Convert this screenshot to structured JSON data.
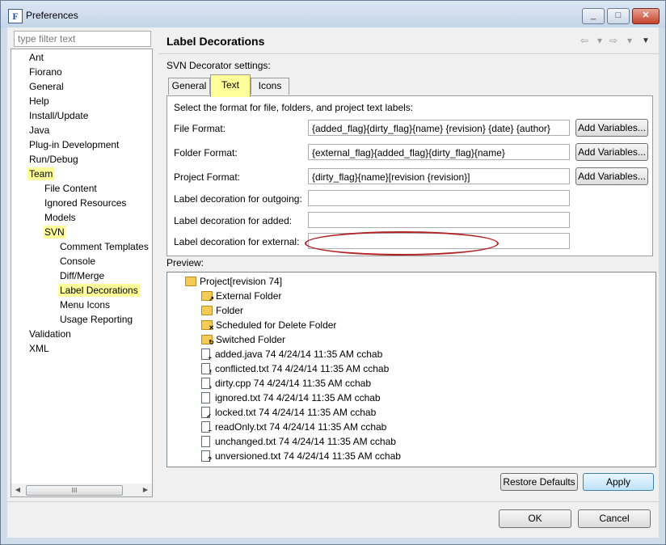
{
  "window": {
    "title": "Preferences",
    "app_icon_letter": "F",
    "buttons": {
      "minimize": "_",
      "maximize": "□",
      "close": "✕"
    }
  },
  "sidebar": {
    "filter_placeholder": "type filter text",
    "items": [
      {
        "label": "Ant",
        "level": 0,
        "highlight": false
      },
      {
        "label": "Fiorano",
        "level": 0,
        "highlight": false
      },
      {
        "label": "General",
        "level": 0,
        "highlight": false
      },
      {
        "label": "Help",
        "level": 0,
        "highlight": false
      },
      {
        "label": "Install/Update",
        "level": 0,
        "highlight": false
      },
      {
        "label": "Java",
        "level": 0,
        "highlight": false
      },
      {
        "label": "Plug-in Development",
        "level": 0,
        "highlight": false
      },
      {
        "label": "Run/Debug",
        "level": 0,
        "highlight": false
      },
      {
        "label": "Team",
        "level": 0,
        "highlight": true
      },
      {
        "label": "File Content",
        "level": 1,
        "highlight": false
      },
      {
        "label": "Ignored Resources",
        "level": 1,
        "highlight": false
      },
      {
        "label": "Models",
        "level": 1,
        "highlight": false
      },
      {
        "label": "SVN",
        "level": 1,
        "highlight": true
      },
      {
        "label": "Comment Templates",
        "level": 2,
        "highlight": false
      },
      {
        "label": "Console",
        "level": 2,
        "highlight": false
      },
      {
        "label": "Diff/Merge",
        "level": 2,
        "highlight": false
      },
      {
        "label": "Label Decorations",
        "level": 2,
        "highlight": true
      },
      {
        "label": "Menu Icons",
        "level": 2,
        "highlight": false
      },
      {
        "label": "Usage Reporting",
        "level": 2,
        "highlight": false
      },
      {
        "label": "Validation",
        "level": 0,
        "highlight": false
      },
      {
        "label": "XML",
        "level": 0,
        "highlight": false
      }
    ],
    "scroll": {
      "left_arrow": "◀",
      "right_arrow": "▶",
      "grip": "III"
    }
  },
  "header": {
    "title": "Label Decorations",
    "nav": {
      "back": "⇦",
      "back_menu": "▾",
      "forward": "⇨",
      "forward_menu": "▾",
      "view_menu": "▼"
    }
  },
  "settings_label": "SVN Decorator settings:",
  "tabs": [
    {
      "label": "General",
      "active": false
    },
    {
      "label": "Text",
      "active": true
    },
    {
      "label": "Icons",
      "active": false
    }
  ],
  "text_tab": {
    "instructions": "Select the format for file, folders, and project text labels:",
    "rows": [
      {
        "label": "File Format:",
        "value": "{added_flag}{dirty_flag}{name} {revision}  {date}  {author}",
        "button": "Add Variables..."
      },
      {
        "label": "Folder Format:",
        "value": "{external_flag}{added_flag}{dirty_flag}{name}",
        "button": "Add Variables..."
      },
      {
        "label": "Project Format:",
        "value": "{dirty_flag}{name}[revision {revision}]",
        "button": "Add Variables..."
      },
      {
        "label": "Label decoration for outgoing:",
        "value": ""
      },
      {
        "label": "Label decoration for added:",
        "value": ""
      },
      {
        "label": "Label decoration for external:",
        "value": ""
      }
    ]
  },
  "preview": {
    "label": "Preview:",
    "items": [
      {
        "text": "Project[revision 74]",
        "icon": "project-folder",
        "overlay": ""
      },
      {
        "text": "External Folder",
        "icon": "folder",
        "overlay": "↗"
      },
      {
        "text": "Folder",
        "icon": "folder",
        "overlay": ""
      },
      {
        "text": "Scheduled for Delete Folder",
        "icon": "folder",
        "overlay": "✕"
      },
      {
        "text": "Switched Folder",
        "icon": "folder",
        "overlay": "↻"
      },
      {
        "text": "added.java 74  4/24/14 11:35 AM  cchab",
        "icon": "file",
        "overlay": "+"
      },
      {
        "text": "conflicted.txt 74  4/24/14 11:35 AM  cchab",
        "icon": "file",
        "overlay": "!"
      },
      {
        "text": "dirty.cpp 74  4/24/14 11:35 AM  cchab",
        "icon": "file",
        "overlay": "›"
      },
      {
        "text": "ignored.txt 74  4/24/14 11:35 AM  cchab",
        "icon": "file",
        "overlay": ""
      },
      {
        "text": "locked.txt 74  4/24/14 11:35 AM  cchab",
        "icon": "file",
        "overlay": "✓"
      },
      {
        "text": "readOnly.txt 74  4/24/14 11:35 AM  cchab",
        "icon": "file",
        "overlay": "–"
      },
      {
        "text": "unchanged.txt 74  4/24/14 11:35 AM  cchab",
        "icon": "file",
        "overlay": ""
      },
      {
        "text": "unversioned.txt 74  4/24/14 11:35 AM  cchab",
        "icon": "file",
        "overlay": "?"
      }
    ]
  },
  "buttons": {
    "restore_defaults": "Restore Defaults",
    "apply": "Apply",
    "ok": "OK",
    "cancel": "Cancel"
  },
  "colors": {
    "highlight": "#ffff99",
    "annotation_ellipse": "#b22222",
    "folder": "#f2cc55"
  }
}
